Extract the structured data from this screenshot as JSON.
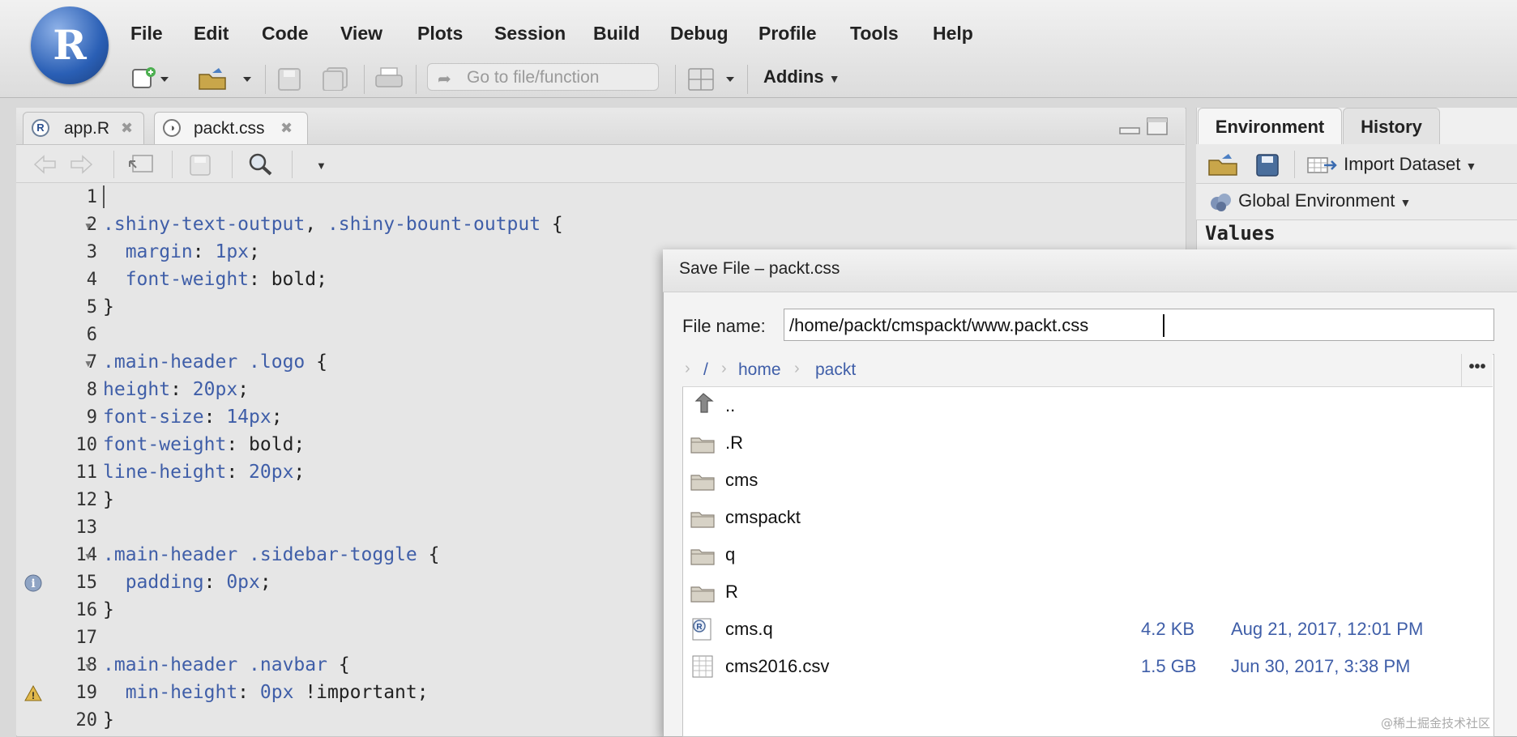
{
  "menu": [
    "File",
    "Edit",
    "Code",
    "View",
    "Plots",
    "Session",
    "Build",
    "Debug",
    "Profile",
    "Tools",
    "Help"
  ],
  "logo_letter": "R",
  "toolbar": {
    "goto_placeholder": "Go to file/function",
    "addins_label": "Addins"
  },
  "editor": {
    "tabs": [
      {
        "label": "app.R",
        "icon": "r-file-icon",
        "active": false
      },
      {
        "label": "packt.css",
        "icon": "css-file-icon",
        "active": true
      }
    ],
    "lines": [
      {
        "n": "1",
        "text": ""
      },
      {
        "n": "2",
        "text": ".shiny-text-output, .shiny-bount-output {"
      },
      {
        "n": "3",
        "text": "  margin: 1px;"
      },
      {
        "n": "4",
        "text": "  font-weight: bold;"
      },
      {
        "n": "5",
        "text": "}"
      },
      {
        "n": "6",
        "text": ""
      },
      {
        "n": "7",
        "text": ".main-header .logo {"
      },
      {
        "n": "8",
        "text": "height: 20px;"
      },
      {
        "n": "9",
        "text": "font-size: 14px;"
      },
      {
        "n": "10",
        "text": "font-weight: bold;"
      },
      {
        "n": "11",
        "text": "line-height: 20px;"
      },
      {
        "n": "12",
        "text": "}"
      },
      {
        "n": "13",
        "text": ""
      },
      {
        "n": "14",
        "text": ".main-header .sidebar-toggle {"
      },
      {
        "n": "15",
        "text": "  padding: 0px;"
      },
      {
        "n": "16",
        "text": "}"
      },
      {
        "n": "17",
        "text": ""
      },
      {
        "n": "18",
        "text": ".main-header .navbar {"
      },
      {
        "n": "19",
        "text": "  min-height: 0px !important;"
      },
      {
        "n": "20",
        "text": "}"
      }
    ],
    "fold_lines": [
      "2",
      "7",
      "14",
      "18"
    ],
    "info_line": "15",
    "warning_line": "19"
  },
  "env": {
    "tabs": [
      "Environment",
      "History"
    ],
    "import_label": "Import Dataset",
    "scope_label": "Global Environment",
    "section_label": "Values"
  },
  "dialog": {
    "title": "Save File – packt.css",
    "file_name_label": "File name:",
    "file_name_value": "/home/packt/cmspackt/www.packt.css",
    "breadcrumb": [
      "/",
      "home",
      "packt"
    ],
    "more_label": "•••",
    "entries": [
      {
        "name": "..",
        "type": "parent",
        "size": "",
        "date": ""
      },
      {
        "name": ".R",
        "type": "folder",
        "size": "",
        "date": ""
      },
      {
        "name": "cms",
        "type": "folder",
        "size": "",
        "date": ""
      },
      {
        "name": "cmspackt",
        "type": "folder",
        "size": "",
        "date": ""
      },
      {
        "name": "q",
        "type": "folder",
        "size": "",
        "date": ""
      },
      {
        "name": "R",
        "type": "folder",
        "size": "",
        "date": ""
      },
      {
        "name": "cms.q",
        "type": "r-file",
        "size": "4.2 KB",
        "date": "Aug 21, 2017, 12:01 PM"
      },
      {
        "name": "cms2016.csv",
        "type": "csv-file",
        "size": "1.5 GB",
        "date": "Jun 30, 2017, 3:38 PM"
      }
    ]
  },
  "watermark": "@稀土掘金技术社区"
}
